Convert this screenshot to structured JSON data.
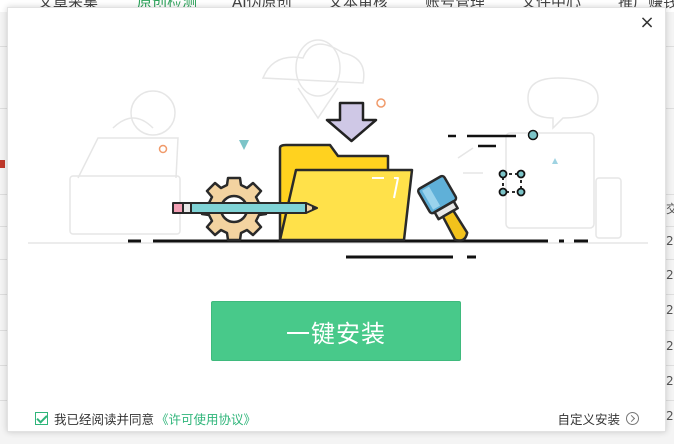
{
  "background": {
    "nav_items": [
      "文章采集",
      "原创检测",
      "AI伪原创",
      "文本审核",
      "账号管理",
      "文件中心",
      "推广赚钱"
    ],
    "active_nav": 1,
    "right_column": [
      "交",
      "2",
      "2",
      "2",
      "2",
      "2",
      "2"
    ]
  },
  "dialog": {
    "close_label": "×",
    "install_button": "一键安装",
    "agree_text": "我已经阅读并同意",
    "license_link": "《许可使用协议》",
    "custom_install": "自定义安装",
    "agree_checked": true
  },
  "colors": {
    "accent": "#48c98a",
    "link": "#2fb57a",
    "folder": "#ffd21f",
    "folder_outline": "#2a2a2a",
    "arrow": "#cfc8e6",
    "gear": "#f3d3a0",
    "pencil": "#7fd3d6",
    "brush_handle": "#f2c21c",
    "brush_head": "#5fb0d8"
  }
}
